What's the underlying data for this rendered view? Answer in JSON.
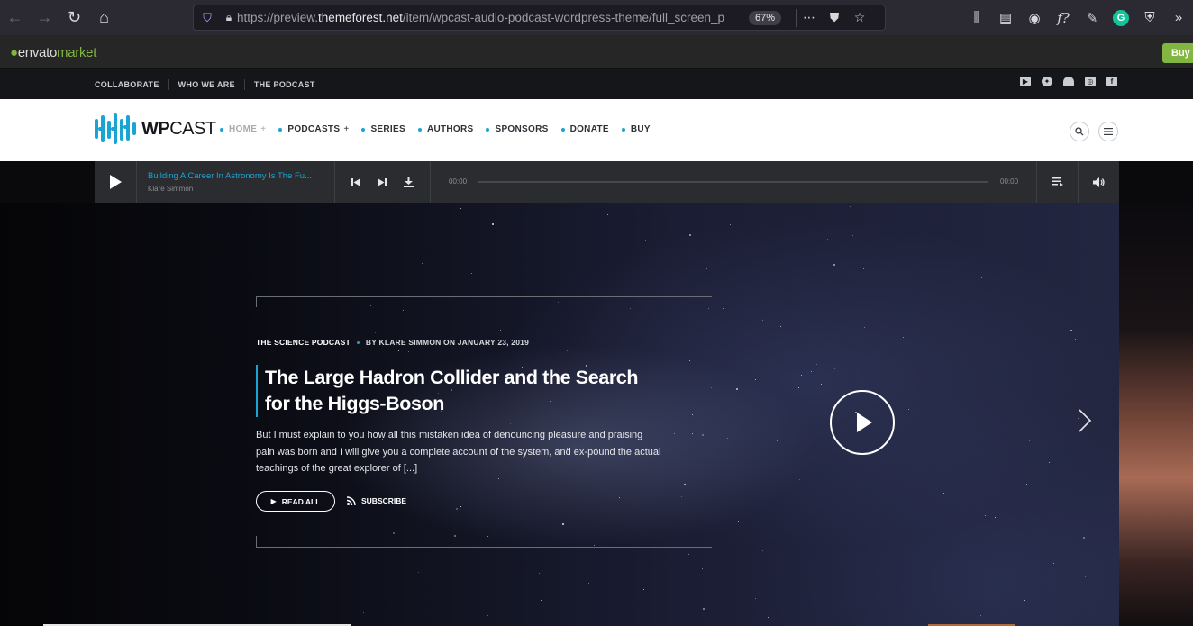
{
  "browser": {
    "url_prefix": "https://preview.",
    "url_domain": "themeforest.net",
    "url_path": "/item/wpcast-audio-podcast-wordpress-theme/full_screen_p",
    "zoom": "67%",
    "more_icon": "⋯",
    "back_icon": "←",
    "forward_icon": "→",
    "reload_icon": "↻",
    "home_icon": "⌂"
  },
  "envato": {
    "logo_main": "envato",
    "logo_suffix": "market",
    "buy_label": "Buy t"
  },
  "topbar": {
    "links": [
      "COLLABORATE",
      "WHO WE ARE",
      "THE PODCAST"
    ]
  },
  "header": {
    "logo_bold": "WP",
    "logo_thin": "CAST",
    "nav": [
      {
        "label": "HOME",
        "has_plus": true,
        "active": true
      },
      {
        "label": "PODCASTS",
        "has_plus": true
      },
      {
        "label": "SERIES"
      },
      {
        "label": "AUTHORS"
      },
      {
        "label": "SPONSORS"
      },
      {
        "label": "DONATE"
      },
      {
        "label": "BUY"
      }
    ],
    "plus": "+"
  },
  "player": {
    "track_title": "Building A Career In Astronomy Is The Fu...",
    "artist": "Klare Simmon",
    "time_current": "00:00",
    "time_total": "00:00",
    "progress": 0
  },
  "hero": {
    "category": "THE SCIENCE PODCAST",
    "byline": "BY KLARE SIMMON ON JANUARY 23, 2019",
    "title": "The Large Hadron Collider and the Search for the Higgs-Boson",
    "excerpt": "But I must explain to you how all this mistaken idea of denouncing pleasure and praising pain was born and I will give you a complete account of the system, and ex-pound the actual teachings of the great explorer of [...]",
    "read_all": "READ ALL",
    "subscribe": "SUBSCRIBE"
  },
  "colors": {
    "accent": "#1aa4d4",
    "envato_green": "#82b541"
  }
}
